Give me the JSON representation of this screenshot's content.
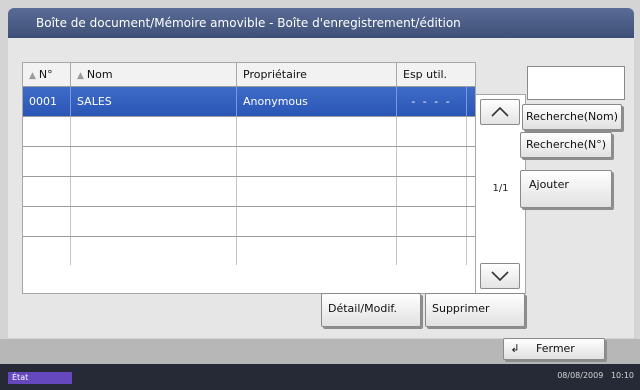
{
  "window": {
    "title": "Boîte de document/Mémoire amovible - Boîte d'enregistrement/édition"
  },
  "table": {
    "headers": [
      "N°",
      "Nom",
      "Propriétaire",
      "Esp util."
    ],
    "rows": [
      [
        "0001",
        "SALES",
        "Anonymous",
        "- - - -"
      ],
      [
        "",
        "",
        "",
        ""
      ],
      [
        "",
        "",
        "",
        ""
      ],
      [
        "",
        "",
        "",
        ""
      ],
      [
        "",
        "",
        "",
        ""
      ],
      [
        "",
        "",
        "",
        ""
      ]
    ],
    "selected_row": 0
  },
  "pager": {
    "page": "1/1"
  },
  "search": {
    "value": ""
  },
  "buttons": {
    "search_name": "Recherche(Nom)",
    "search_number": "Recherche(N°)",
    "add": "Ajouter",
    "detail": "Détail/Modif.",
    "delete": "Supprimer",
    "close": "Fermer"
  },
  "status": {
    "state": "État",
    "date": "08/08/2009",
    "time": "10:10"
  },
  "colors": {
    "selected": "#3a66c4",
    "title_bar": "#4b5d87",
    "footer": "#262a36",
    "state_badge": "#6548bd"
  },
  "icons": {
    "up": "chevron-up-icon",
    "down": "chevron-down-icon",
    "return": "return-arrow-icon",
    "sort": "sort-triangle-icon"
  }
}
